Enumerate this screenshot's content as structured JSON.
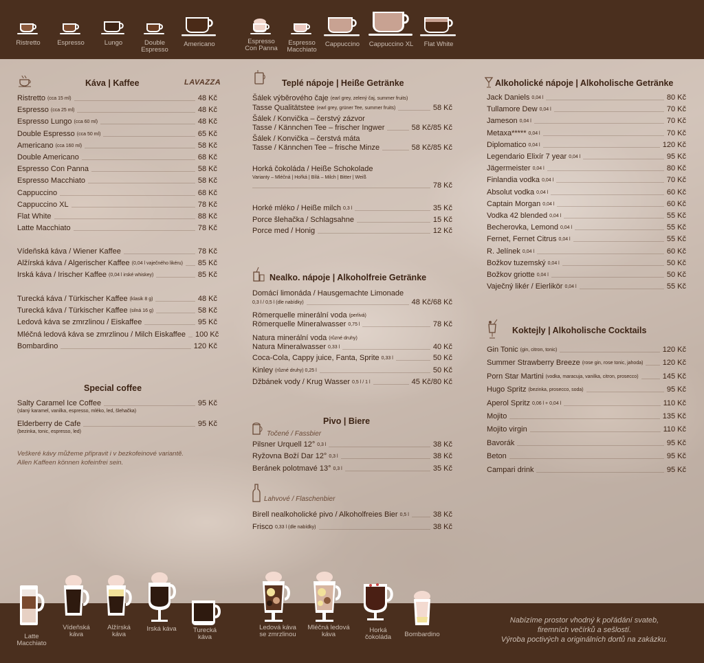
{
  "top_cups": [
    "Ristretto",
    "Espresso",
    "Lungo",
    "Double Espresso",
    "Americano",
    "Espresso Con Panna",
    "Espresso Macchiato",
    "Cappuccino",
    "Cappuccino XL",
    "Flat White"
  ],
  "bottom_cups": [
    "Latte Macchiato",
    "Vídeňská káva",
    "Alžírská káva",
    "Irská káva",
    "Turecká káva",
    "Ledová káva se zmrzlinou",
    "Mléčná ledová káva",
    "Horká čokoláda",
    "Bombardino"
  ],
  "coffee": {
    "title": "Káva | Kaffee",
    "brand": "LAVAZZA",
    "items": [
      {
        "name": "Ristretto",
        "note": "(cca 15 ml)",
        "price": "48 Kč"
      },
      {
        "name": "Espresso",
        "note": "(cca 25 ml)",
        "price": "48 Kč"
      },
      {
        "name": "Espresso Lungo",
        "note": "(cca 60 ml)",
        "price": "48 Kč"
      },
      {
        "name": "Double Espresso",
        "note": "(cca 50 ml)",
        "price": "65 Kč"
      },
      {
        "name": "Americano",
        "note": "(cca 160 ml)",
        "price": "58 Kč"
      },
      {
        "name": "Double Americano",
        "note": "",
        "price": "68 Kč"
      },
      {
        "name": "Espresso Con Panna",
        "note": "",
        "price": "58 Kč"
      },
      {
        "name": "Espresso Macchiato",
        "note": "",
        "price": "58 Kč"
      },
      {
        "name": "Cappuccino",
        "note": "",
        "price": "68 Kč"
      },
      {
        "name": "Cappuccino XL",
        "note": "",
        "price": "78 Kč"
      },
      {
        "name": "Flat White",
        "note": "",
        "price": "88 Kč"
      },
      {
        "name": "Latte Macchiato",
        "note": "",
        "price": "78 Kč"
      }
    ],
    "items2": [
      {
        "name": "Vídeňská káva / Wiener Kaffee",
        "note": "",
        "price": "78 Kč"
      },
      {
        "name": "Alžírská káva / Algerischer Kaffee",
        "note": "(0,04 l vaječného likéru)",
        "price": "85 Kč"
      },
      {
        "name": "Irská káva / Irischer Kaffee",
        "note": "(0,04 l irské whiskey)",
        "price": "85 Kč"
      }
    ],
    "items3": [
      {
        "name": "Turecká káva / Türkischer Kaffee",
        "note": "(klasik 8 g)",
        "price": "48 Kč"
      },
      {
        "name": "Turecká káva / Türkischer Kaffee",
        "note": "(silná 16 g)",
        "price": "58 Kč"
      },
      {
        "name": "Ledová káva se zmrzlinou / Eiskaffee",
        "note": "",
        "price": "95 Kč"
      },
      {
        "name": "Mléčná ledová káva se zmrzlinou / Milch Eiskaffee",
        "note": "",
        "price": "100 Kč"
      },
      {
        "name": "Bombardino",
        "note": "",
        "price": "120 Kč"
      }
    ]
  },
  "special": {
    "title": "Special  coffee",
    "items": [
      {
        "name": "Salty Caramel Ice Coffee",
        "sub": "(slaný karamel, vanilka, espresso, mléko, led, šlehačka)",
        "price": "95 Kč"
      },
      {
        "name": "Elderberry de Cafe",
        "sub": "(bezinka, tonic, espresso, led)",
        "price": "95 Kč"
      }
    ],
    "note_line1": "Veškeré kávy můžeme připravit i v bezkofeinové variantě.",
    "note_line2": "Allen Kaffeen können kofeinfrei sein."
  },
  "hot": {
    "title": "Teplé nápoje | Heiße Getränke",
    "tea1_l1": "Šálek výběrového čaje",
    "tea1_l1_note": "(earl grey, zelený čaj, summer fruits)",
    "tea1_l2": "Tasse Qualitätstee",
    "tea1_l2_note": "(earl grey, grüner Tee, summer fruits)",
    "tea1_price": "58 Kč",
    "tea2_l1": "Šálek / Konvička – čerstvý zázvor",
    "tea2_l2": "Tasse / Kännchen Tee – frischer Ingwer",
    "tea2_price": "58 Kč/85 Kč",
    "tea3_l1": "Šálek / Konvička – čerstvá máta",
    "tea3_l2": "Tasse / Kännchen Tee – frische Minze",
    "tea3_price": "58 Kč/85 Kč",
    "choc_l1": "Horká čokoláda / Heiße Schokolade",
    "choc_l2": "Varianty – Mléčná | Hořká | Bílá – Milch | Bitter | Weiß",
    "choc_price": "78 Kč",
    "items": [
      {
        "name": "Horké mléko / Heiße milch",
        "note": "0,3 l",
        "price": "35 Kč"
      },
      {
        "name": "Porce šlehačka / Schlagsahne",
        "note": "",
        "price": "15 Kč"
      },
      {
        "name": "Porce med / Honig",
        "note": "",
        "price": "12 Kč"
      }
    ]
  },
  "soft": {
    "title": "Nealko. nápoje | Alkoholfreie Getränke",
    "lim_l1": "Domácí limonáda / Hausgemachte Limonade",
    "lim_l2": "0,3 l / 0,5 l (dle nabídky)",
    "lim_price": "48 Kč/68 Kč",
    "rom_l1": "Römerquelle minerální voda",
    "rom_l1_note": "(perlivá)",
    "rom_l2": "Römerquelle Mineralwasser",
    "rom_l2_note": "0,75 l",
    "rom_price": "78 Kč",
    "nat_l1": "Natura minerální voda",
    "nat_l1_note": "(různé druhy)",
    "nat_l2": "Natura Mineralwasser",
    "nat_l2_note": "0,33 l",
    "nat_price": "40 Kč",
    "items": [
      {
        "name": "Coca-Cola, Cappy juice, Fanta, Sprite",
        "note": "0,33 l",
        "price": "50 Kč"
      },
      {
        "name": "Kinley",
        "note": "(různé druhy)   0,25 l",
        "price": "50 Kč"
      },
      {
        "name": "Džbánek vody / Krug Wasser",
        "note": "0,5 l / 1 l",
        "price": "45 Kč/80 Kč"
      }
    ]
  },
  "beer": {
    "title": "Pivo | Biere",
    "draft_label": "Točené / Fassbier",
    "draft": [
      {
        "name": "Pilsner Urquell 12°",
        "note": "0,3 l",
        "price": "38 Kč"
      },
      {
        "name": "Ryžovna Boží Dar 12°",
        "note": "0,3 l",
        "price": "38 Kč"
      },
      {
        "name": "Beránek polotmavé 13°",
        "note": "0,3 l",
        "price": "35 Kč"
      }
    ],
    "bottle_label": "Lahvové / Flaschenbier",
    "bottle": [
      {
        "name": "Birell nealkoholické pivo / Alkoholfreies Bier",
        "note": "0,5 l",
        "price": "38 Kč"
      },
      {
        "name": "Frisco",
        "note": "0,33 l  (dle nabídky)",
        "price": "38 Kč"
      }
    ]
  },
  "alcohol": {
    "title": "Alkoholické nápoje | Alkoholische Getränke",
    "items": [
      {
        "name": "Jack Daniels",
        "note": "0,04 l",
        "price": "80 Kč"
      },
      {
        "name": "Tullamore Dew",
        "note": "0,04 l",
        "price": "70 Kč"
      },
      {
        "name": "Jameson",
        "note": "0,04 l",
        "price": "70 Kč"
      },
      {
        "name": "Metaxa*****",
        "note": "0,04 l",
        "price": "70 Kč"
      },
      {
        "name": "Diplomatico",
        "note": "0,04 l",
        "price": "120 Kč"
      },
      {
        "name": "Legendario Elixír 7 year",
        "note": "0,04 l",
        "price": "95 Kč"
      },
      {
        "name": "Jägermeister",
        "note": "0,04 l",
        "price": "80 Kč"
      },
      {
        "name": "Finlandia vodka",
        "note": "0,04 l",
        "price": "70 Kč"
      },
      {
        "name": "Absolut vodka",
        "note": "0,04 l",
        "price": "60 Kč"
      },
      {
        "name": "Captain Morgan",
        "note": "0,04 l",
        "price": "60 Kč"
      },
      {
        "name": "Vodka 42 blended",
        "note": "0,04 l",
        "price": "55 Kč"
      },
      {
        "name": "Becherovka, Lemond",
        "note": "0,04 l",
        "price": "55 Kč"
      },
      {
        "name": "Fernet, Fernet Citrus",
        "note": "0,04 l",
        "price": "55 Kč"
      },
      {
        "name": "R. Jelínek",
        "note": "0,04 l",
        "price": "60 Kč"
      },
      {
        "name": "Božkov tuzemský",
        "note": "0,04 l",
        "price": "50 Kč"
      },
      {
        "name": "Božkov griotte",
        "note": "0,04 l",
        "price": "50 Kč"
      },
      {
        "name": "Vaječný likér / Eierlikör",
        "note": "0,04 l",
        "price": "55 Kč"
      }
    ]
  },
  "cocktails": {
    "title": "Koktejly | Alkoholische Cocktails",
    "items": [
      {
        "name": "Gin Tonic",
        "note": "(gin, citron, tonic)",
        "price": "120 Kč"
      },
      {
        "name": "Summer Strawberry Breeze",
        "note": "(rose gin, rose tonic, jahoda)",
        "price": "120 Kč"
      },
      {
        "name": "Porn Star Martini",
        "note": "(vodka, maracuja, vanilka, citron, prosecco)",
        "price": "145 Kč"
      },
      {
        "name": "Hugo Spritz",
        "note": "(bezinka, prosecco, soda)",
        "price": "95 Kč"
      },
      {
        "name": "Aperol Spritz",
        "note": "0,06 l + 0,04 l",
        "price": "110 Kč"
      },
      {
        "name": "Mojito",
        "note": "",
        "price": "135 Kč"
      },
      {
        "name": "Mojito virgin",
        "note": "",
        "price": "110 Kč"
      },
      {
        "name": "Bavorák",
        "note": "",
        "price": "95 Kč"
      },
      {
        "name": "Beton",
        "note": "",
        "price": "95 Kč"
      },
      {
        "name": "Campari drink",
        "note": "",
        "price": "95 Kč"
      }
    ]
  },
  "bottom_note": {
    "l1": "Nabízíme prostor vhodný k pořádání svateb,",
    "l2": "firemních večírků a sešlostí.",
    "l3": "Výroba poctivých a originálních dortů na zakázku."
  },
  "colors": {
    "dark_brown": "#4a2f1e",
    "text": "#3c2314",
    "cup_label": "#cdbfb4"
  }
}
